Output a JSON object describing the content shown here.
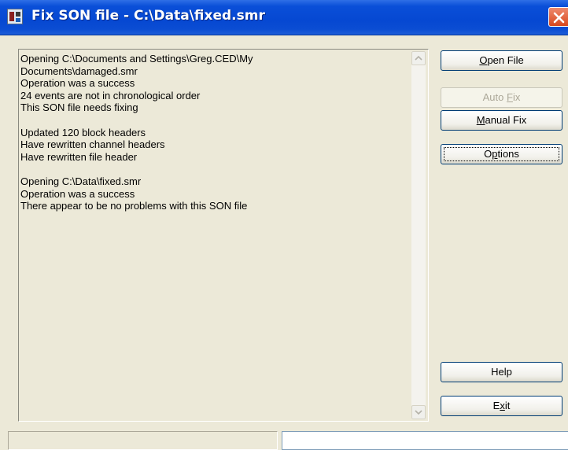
{
  "window": {
    "title": "Fix SON file - C:\\Data\\fixed.smr",
    "app_icon": "son-fix-app-icon",
    "close_icon": "close-icon"
  },
  "log": {
    "lines": [
      "Opening C:\\Documents and Settings\\Greg.CED\\My",
      "Documents\\damaged.smr",
      "Operation was a success",
      "24 events are not in chronological order",
      "This SON file needs fixing",
      "",
      "Updated 120 block headers",
      "Have rewritten channel headers",
      "Have rewritten file header",
      "",
      "Opening C:\\Data\\fixed.smr",
      "Operation was a success",
      "There appear to be no problems with this SON file"
    ]
  },
  "buttons": {
    "open_file": {
      "mnemonic": "O",
      "rest": "pen File"
    },
    "auto_fix": {
      "pre": "Auto ",
      "mnemonic": "F",
      "rest": "ix",
      "enabled": false
    },
    "manual_fix": {
      "mnemonic": "M",
      "rest": "anual Fix"
    },
    "options": {
      "pre": "O",
      "mnemonic": "p",
      "rest": "tions"
    },
    "help": {
      "label": "Help"
    },
    "exit": {
      "pre": "E",
      "mnemonic": "x",
      "rest": "it"
    }
  },
  "status": {
    "left": "",
    "right": ""
  },
  "colors": {
    "titlebar": "#0648d2",
    "face": "#ece9d8",
    "close": "#d8481e",
    "button_border": "#003c74"
  }
}
